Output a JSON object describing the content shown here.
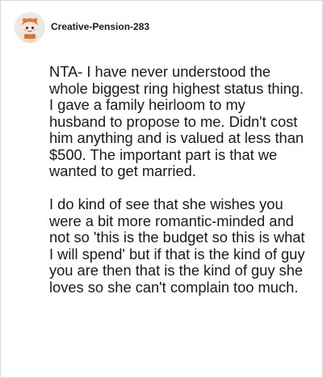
{
  "comment": {
    "username": "Creative-Pension-283",
    "avatar_icon": "snoo-avatar-icon",
    "paragraphs": [
      "NTA- I have never understood the whole biggest ring highest status thing. I gave a family heirloom to my husband to propose to me. Didn't cost him anything and is valued at less than $500. The important part is that we wanted to get married.",
      "I do kind of see that she wishes you were a bit more romantic-minded and not so 'this is the budget so this is what I will spend' but if that is the kind of guy you are then that is the kind of guy she loves so she can't complain too much."
    ]
  },
  "colors": {
    "text": "#1a1a1b",
    "border": "#d9d9d9",
    "background": "#ffffff"
  }
}
